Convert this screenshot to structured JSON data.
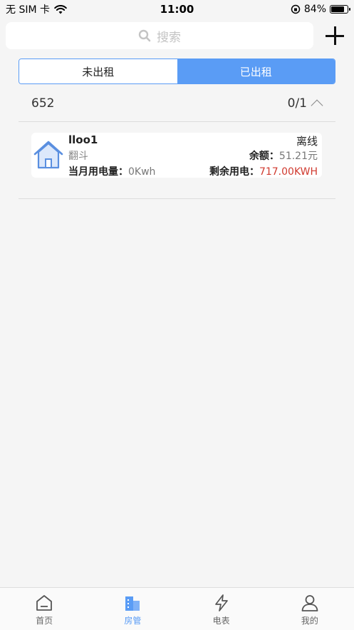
{
  "status_bar": {
    "carrier": "无 SIM 卡",
    "time": "11:00",
    "battery": "84%",
    "battery_level": 0.84
  },
  "search": {
    "placeholder": "搜索"
  },
  "tabs_segment": [
    {
      "label": "未出租",
      "active": false
    },
    {
      "label": "已出租",
      "active": true
    }
  ],
  "group": {
    "name": "652",
    "count": "0/1"
  },
  "room": {
    "name": "lloo1",
    "subtitle": "翻斗",
    "status": "离线",
    "month_usage_label": "当月用电量：",
    "month_usage_value": "0Kwh",
    "balance_label": "余额：",
    "balance_value": "51.21元",
    "remaining_label": "剩余用电：",
    "remaining_value": "717.00KWH"
  },
  "bottom_nav": [
    {
      "label": "首页",
      "icon": "home-icon"
    },
    {
      "label": "房管",
      "icon": "building-icon",
      "active": true
    },
    {
      "label": "电表",
      "icon": "lightning-icon"
    },
    {
      "label": "我的",
      "icon": "person-icon"
    }
  ],
  "colors": {
    "accent": "#5a9cf5",
    "red": "#d03a2f"
  }
}
